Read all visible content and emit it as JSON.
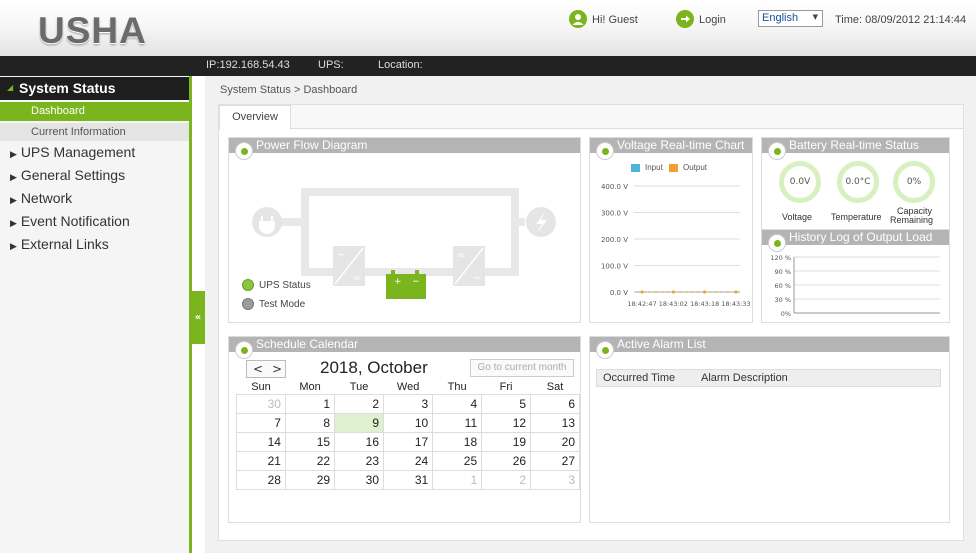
{
  "header": {
    "logo": "USHA",
    "greeting": "Hi! Guest",
    "login": "Login",
    "language": "English",
    "time": "Time: 08/09/2012 21:14:44"
  },
  "infobar": {
    "ip": "IP:192.168.54.43",
    "ups": "UPS:",
    "location": "Location:"
  },
  "sidebar": {
    "system_status": "System Status",
    "dashboard": "Dashboard",
    "current_information": "Current Information",
    "ups_management": "UPS Management",
    "general_settings": "General Settings",
    "network": "Network",
    "event_notification": "Event Notification",
    "external_links": "External Links"
  },
  "breadcrumb": "System Status > Dashboard",
  "tabs": {
    "overview": "Overview"
  },
  "power_flow": {
    "title": "Power Flow Diagram",
    "ups_status": "UPS Status",
    "test_mode": "Test Mode"
  },
  "voltage_chart": {
    "title": "Voltage Real-time Chart",
    "legend_input": "Input",
    "legend_output": "Output",
    "y_ticks": [
      "400.0 V",
      "300.0 V",
      "200.0 V",
      "100.0 V",
      "0.0 V"
    ],
    "x_ticks": [
      "18:42:47",
      "18:43:02",
      "18:43:18",
      "18:43:33"
    ]
  },
  "battery": {
    "title": "Battery Real-time Status",
    "voltage_value": "0.0V",
    "voltage_label": "Voltage",
    "temperature_value": "0.0°C",
    "temperature_label": "Temperature",
    "capacity_value": "0%",
    "capacity_label_1": "Capacity",
    "capacity_label_2": "Remaining"
  },
  "history": {
    "title": "History Log of Output Load",
    "y_ticks": [
      "120 %",
      "90 %",
      "60 %",
      "30 %",
      "0%"
    ]
  },
  "calendar": {
    "title": "Schedule Calendar",
    "prev": "<",
    "next": ">",
    "month": "2018, October",
    "goto_current": "Go to current month",
    "weekdays": [
      "Sun",
      "Mon",
      "Tue",
      "Wed",
      "Thu",
      "Fri",
      "Sat"
    ],
    "rows": [
      [
        "30",
        "1",
        "2",
        "3",
        "4",
        "5",
        "6"
      ],
      [
        "7",
        "8",
        "9",
        "10",
        "11",
        "12",
        "13"
      ],
      [
        "14",
        "15",
        "16",
        "17",
        "18",
        "19",
        "20"
      ],
      [
        "21",
        "22",
        "23",
        "24",
        "25",
        "26",
        "27"
      ],
      [
        "28",
        "29",
        "30",
        "31",
        "1",
        "2",
        "3"
      ]
    ]
  },
  "alarm": {
    "title": "Active Alarm List",
    "col_time": "Occurred Time",
    "col_desc": "Alarm Description"
  },
  "chart_data": {
    "type": "line",
    "title": "Voltage Real-time Chart",
    "x": [
      "18:42:47",
      "18:43:02",
      "18:43:18",
      "18:43:33"
    ],
    "ylim": [
      0,
      400
    ],
    "series": [
      {
        "name": "Input",
        "values": [
          0,
          0,
          0,
          0
        ]
      },
      {
        "name": "Output",
        "values": [
          0,
          0,
          0,
          0
        ]
      }
    ]
  },
  "colors": {
    "accent": "#7ab51d",
    "panel_title": "#b4b4b4",
    "input": "#4fb3d9",
    "output": "#f0a030"
  }
}
